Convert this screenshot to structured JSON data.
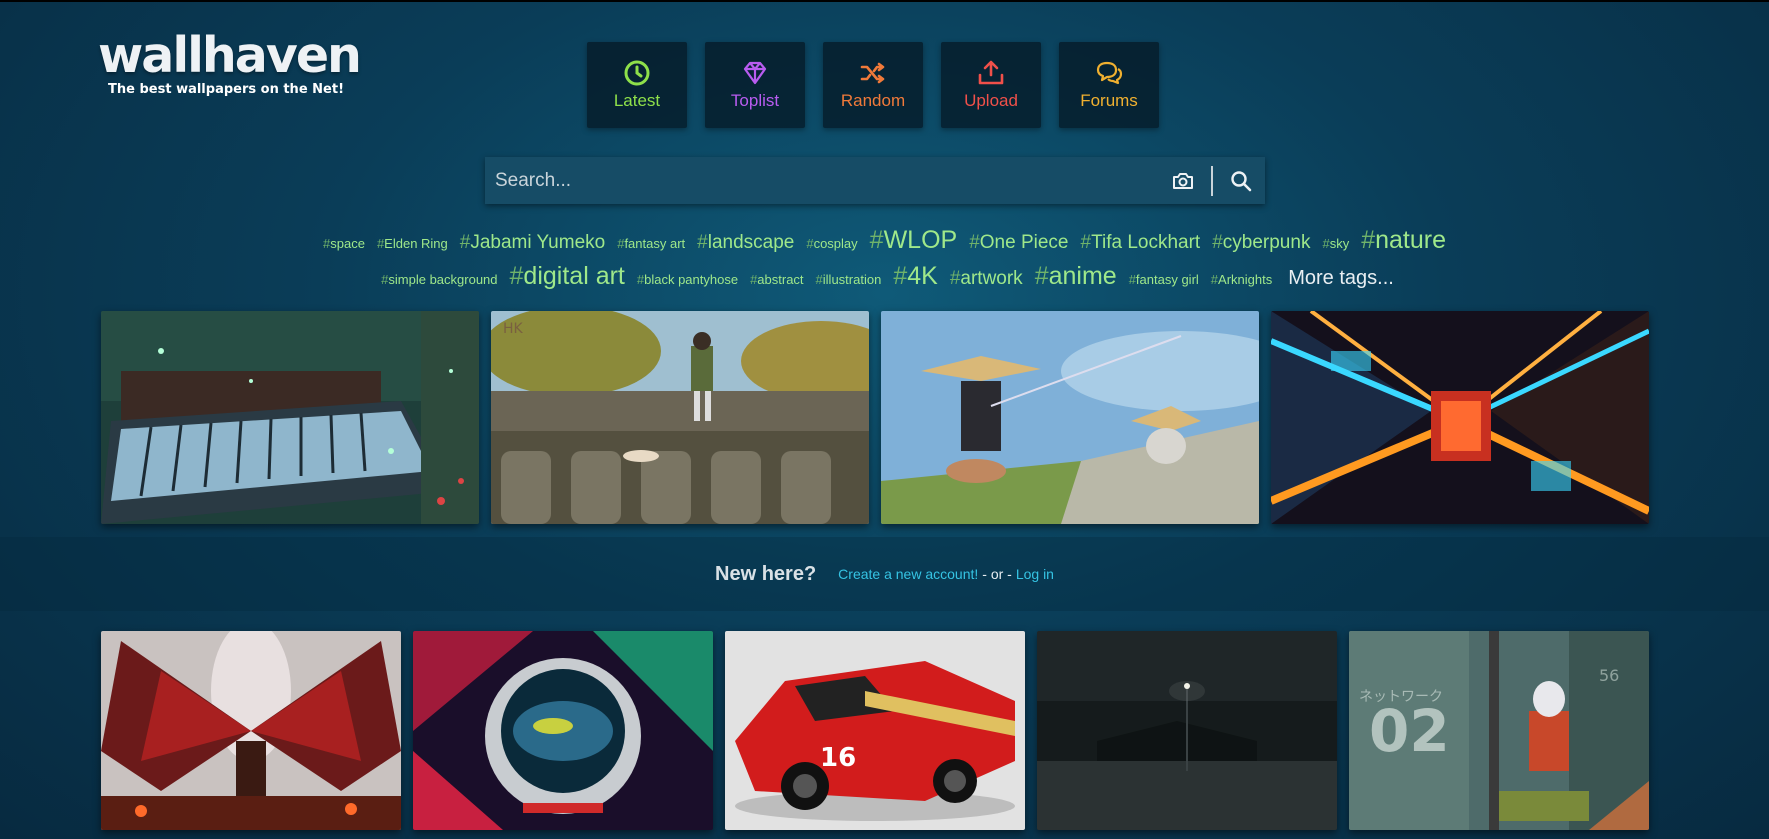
{
  "logo": {
    "name": "wallhaven",
    "tagline": "The best wallpapers on the Net!"
  },
  "nav": [
    {
      "label": "Latest",
      "icon": "clock-icon",
      "color": "#8ee04a"
    },
    {
      "label": "Toplist",
      "icon": "diamond-icon",
      "color": "#b85cf0"
    },
    {
      "label": "Random",
      "icon": "shuffle-icon",
      "color": "#f07a3a"
    },
    {
      "label": "Upload",
      "icon": "upload-icon",
      "color": "#f0504a"
    },
    {
      "label": "Forums",
      "icon": "comments-icon",
      "color": "#f0b030"
    }
  ],
  "search": {
    "placeholder": "Search..."
  },
  "tags_row1": [
    {
      "text": "space",
      "size": "sm"
    },
    {
      "text": "Elden Ring",
      "size": "sm"
    },
    {
      "text": "Jabami Yumeko",
      "size": "md"
    },
    {
      "text": "fantasy art",
      "size": "sm"
    },
    {
      "text": "landscape",
      "size": "md"
    },
    {
      "text": "cosplay",
      "size": "sm"
    },
    {
      "text": "WLOP",
      "size": "lg"
    },
    {
      "text": "One Piece",
      "size": "md"
    },
    {
      "text": "Tifa Lockhart",
      "size": "md"
    },
    {
      "text": "cyberpunk",
      "size": "md"
    },
    {
      "text": "sky",
      "size": "sm"
    },
    {
      "text": "nature",
      "size": "lg"
    }
  ],
  "tags_row2": [
    {
      "text": "simple background",
      "size": "sm"
    },
    {
      "text": "digital art",
      "size": "lg"
    },
    {
      "text": "black pantyhose",
      "size": "sm"
    },
    {
      "text": "abstract",
      "size": "sm"
    },
    {
      "text": "illustration",
      "size": "sm"
    },
    {
      "text": "4K",
      "size": "lg"
    },
    {
      "text": "artwork",
      "size": "md"
    },
    {
      "text": "anime",
      "size": "lg"
    },
    {
      "text": "fantasy girl",
      "size": "sm"
    },
    {
      "text": "Arknights",
      "size": "sm"
    }
  ],
  "more_tags": "More tags...",
  "tag_hash": "#",
  "new_here": {
    "question": "New here?",
    "create": "Create a new account!",
    "or": "- or -",
    "login": "Log in"
  },
  "thumb_text": {
    "hk": "HK",
    "jp": "ネットワーク",
    "num02": "02",
    "num56": "56",
    "car16": "16"
  }
}
